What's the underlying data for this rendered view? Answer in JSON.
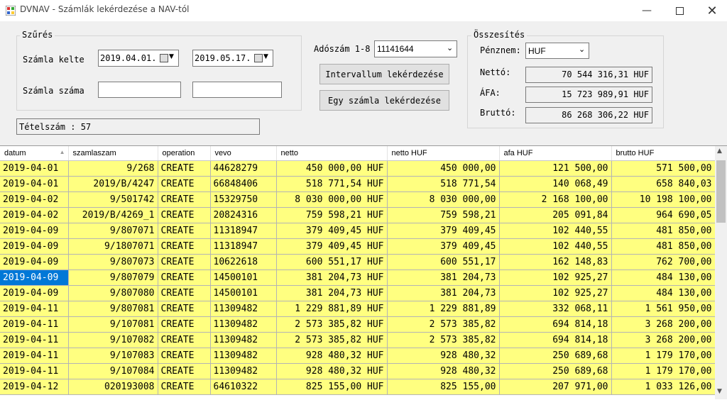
{
  "window": {
    "title": "DVNAV - Számlák lekérdezése a NAV-tól"
  },
  "filter": {
    "group_label": "Szűrés",
    "date_label": "Számla kelte",
    "date_from": "2019.04.01.",
    "date_to": "2019.05.17.",
    "invoice_number_label": "Számla száma",
    "invoice_number_from": "",
    "invoice_number_to": ""
  },
  "tax": {
    "label": "Adószám 1-8",
    "value": "11141644"
  },
  "buttons": {
    "interval": "Intervallum lekérdezése",
    "single": "Egy számla lekérdezése"
  },
  "item_count": "Tételszám : 57",
  "summary": {
    "group_label": "Összesítés",
    "currency_label": "Pénznem:",
    "currency_value": "HUF",
    "net_label": "Nettó:",
    "net_value": "70 544 316,31 HUF",
    "vat_label": "ÁFA:",
    "vat_value": "15 723 989,91 HUF",
    "gross_label": "Bruttó:",
    "gross_value": "86 268 306,22 HUF"
  },
  "table": {
    "columns": [
      "datum",
      "szamlaszam",
      "operation",
      "vevo",
      "netto",
      "netto HUF",
      "afa HUF",
      "brutto HUF"
    ],
    "rows": [
      [
        "2019-04-01",
        "9/268",
        "CREATE",
        "44628279",
        "450 000,00 HUF",
        "450 000,00",
        "121 500,00",
        "571 500,00"
      ],
      [
        "2019-04-01",
        "2019/B/4247",
        "CREATE",
        "66848406",
        "518 771,54 HUF",
        "518 771,54",
        "140 068,49",
        "658 840,03"
      ],
      [
        "2019-04-02",
        "9/501742",
        "CREATE",
        "15329750",
        "8 030 000,00 HUF",
        "8 030 000,00",
        "2 168 100,00",
        "10 198 100,00"
      ],
      [
        "2019-04-02",
        "2019/B/4269_1",
        "CREATE",
        "20824316",
        "759 598,21 HUF",
        "759 598,21",
        "205 091,84",
        "964 690,05"
      ],
      [
        "2019-04-09",
        "9/807071",
        "CREATE",
        "11318947",
        "379 409,45 HUF",
        "379 409,45",
        "102 440,55",
        "481 850,00"
      ],
      [
        "2019-04-09",
        "9/1807071",
        "CREATE",
        "11318947",
        "379 409,45 HUF",
        "379 409,45",
        "102 440,55",
        "481 850,00"
      ],
      [
        "2019-04-09",
        "9/807073",
        "CREATE",
        "10622618",
        "600 551,17 HUF",
        "600 551,17",
        "162 148,83",
        "762 700,00"
      ],
      [
        "2019-04-09",
        "9/807079",
        "CREATE",
        "14500101",
        "381 204,73 HUF",
        "381 204,73",
        "102 925,27",
        "484 130,00"
      ],
      [
        "2019-04-09",
        "9/807080",
        "CREATE",
        "14500101",
        "381 204,73 HUF",
        "381 204,73",
        "102 925,27",
        "484 130,00"
      ],
      [
        "2019-04-11",
        "9/807081",
        "CREATE",
        "11309482",
        "1 229 881,89 HUF",
        "1 229 881,89",
        "332 068,11",
        "1 561 950,00"
      ],
      [
        "2019-04-11",
        "9/107081",
        "CREATE",
        "11309482",
        "2 573 385,82 HUF",
        "2 573 385,82",
        "694 814,18",
        "3 268 200,00"
      ],
      [
        "2019-04-11",
        "9/107082",
        "CREATE",
        "11309482",
        "2 573 385,82 HUF",
        "2 573 385,82",
        "694 814,18",
        "3 268 200,00"
      ],
      [
        "2019-04-11",
        "9/107083",
        "CREATE",
        "11309482",
        "928 480,32 HUF",
        "928 480,32",
        "250 689,68",
        "1 179 170,00"
      ],
      [
        "2019-04-11",
        "9/107084",
        "CREATE",
        "11309482",
        "928 480,32 HUF",
        "928 480,32",
        "250 689,68",
        "1 179 170,00"
      ],
      [
        "2019-04-12",
        "020193008",
        "CREATE",
        "64610322",
        "825 155,00 HUF",
        "825 155,00",
        "207 971,00",
        "1 033 126,00"
      ]
    ],
    "selected_row": 7
  },
  "colors": {
    "row_bg": "#ffff80",
    "selection": "#0078d7"
  }
}
